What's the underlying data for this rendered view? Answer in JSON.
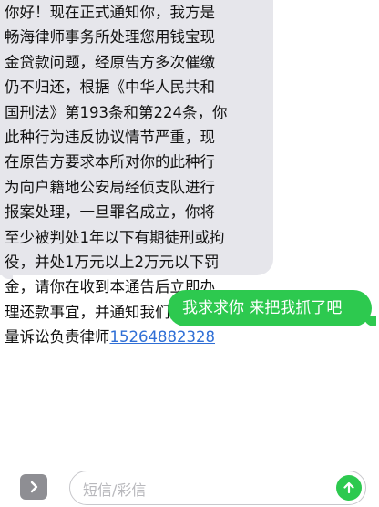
{
  "thread": {
    "incoming_message": {
      "lines": [
        "你好！现在正式通知你，我方是",
        "畅海律师事务所处理您用钱宝现",
        "金贷款问题，经原告方多次催缴",
        "仍不归还，根据《中华人民共和",
        "国刑法》第193条和第224条，你",
        "此种行为违反协议情节严重，现",
        "在原告方要求本所对你的此种行",
        "为向户籍地公安局经侦支队进行",
        "报案处理，一旦罪名成立，你将",
        "至少被判处1年以下有期徒刑或拘",
        "役，并处1万元以上2万元以下罚",
        "金，请你在收到本通告后立即办",
        "理还款事宜，并通知我们,案件批"
      ],
      "last_line_prefix": "量诉讼负责律师",
      "phone_number": "15264882328"
    },
    "outgoing_message": {
      "text": "我求求你 来把我抓了吧"
    }
  },
  "composer": {
    "placeholder": "短信/彩信",
    "value": "",
    "expand_icon": "chevron-right-icon",
    "send_icon": "arrow-up-icon"
  },
  "colors": {
    "incoming_bubble": "#e6e6eb",
    "outgoing_bubble": "#2dc94f",
    "link": "#2f6fd6",
    "expand_button": "#8e8e93"
  }
}
